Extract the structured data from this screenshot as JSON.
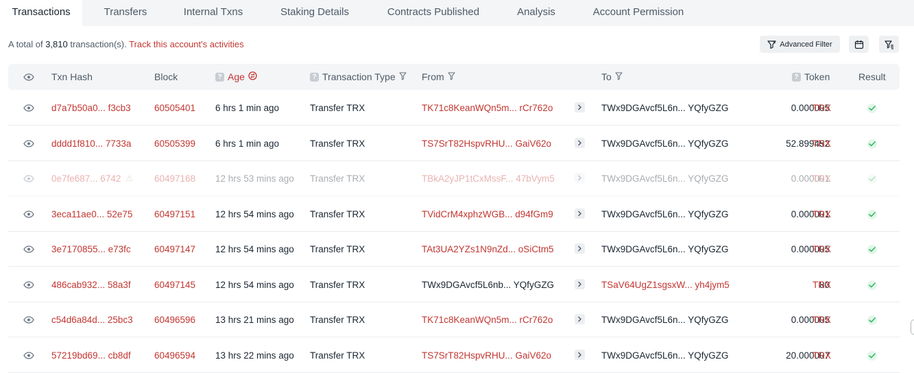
{
  "tabs": [
    {
      "label": "Transactions",
      "active": true
    },
    {
      "label": "Transfers"
    },
    {
      "label": "Internal Txns"
    },
    {
      "label": "Staking Details"
    },
    {
      "label": "Contracts Published"
    },
    {
      "label": "Analysis"
    },
    {
      "label": "Account Permission"
    }
  ],
  "summary": {
    "prefix": "A total of ",
    "count": "3,810",
    "suffix": " transaction(s).",
    "track_link": "Track this account's activities"
  },
  "toolbar": {
    "advanced_filter": "Advanced Filter",
    "calendar_icon": "calendar-icon",
    "filter_icon": "filter-list-icon"
  },
  "columns": {
    "txn_hash": "Txn Hash",
    "block": "Block",
    "age": "Age",
    "transaction_type": "Transaction Type",
    "from": "From",
    "to": "To",
    "token": "Token",
    "result": "Result"
  },
  "colors": {
    "accent_red": "#c23631",
    "success_green": "#2fb85d",
    "header_bg": "#f3f5f7"
  },
  "rows": [
    {
      "hash": "d7a7b50a0... f3cb3",
      "block": "60505401",
      "age": "6 hrs 1 min ago",
      "type": "Transfer TRX",
      "from": "TK71c8KeanWQn5m... rCr762o",
      "to": "TWx9DGAvcf5L6n... YQfyGZG",
      "amount": "0.000005",
      "token": "TRX"
    },
    {
      "hash": "dddd1f810... 7733a",
      "block": "60505399",
      "age": "6 hrs 1 min ago",
      "type": "Transfer TRX",
      "from": "TS7SrT82HspvRHU... GaiV62o",
      "to": "TWx9DGAvcf5L6n... YQfyGZG",
      "amount": "52.899452",
      "token": "TRX"
    },
    {
      "hash": "0e7fe687... 6742",
      "block": "60497168",
      "age": "12 hrs 53 mins ago",
      "type": "Transfer TRX",
      "from": "TBkA2yJP1tCxMssF... 47bVym5",
      "to": "TWx9DGAvcf5L6n... YQfyGZG",
      "amount": "0.000001",
      "token": "TRX",
      "faded": true
    },
    {
      "hash": "3eca11ae0... 52e75",
      "block": "60497151",
      "age": "12 hrs 54 mins ago",
      "type": "Transfer TRX",
      "from": "TVidCrM4xphzWGB... d94fGm9",
      "to": "TWx9DGAvcf5L6n... YQfyGZG",
      "amount": "0.000001",
      "token": "TRX"
    },
    {
      "hash": "3e7170855... e73fc",
      "block": "60497147",
      "age": "12 hrs 54 mins ago",
      "type": "Transfer TRX",
      "from": "TAt3UA2YZs1N9nZd... oSiCtm5",
      "to": "TWx9DGAvcf5L6n... YQfyGZG",
      "amount": "0.000005",
      "token": "TRX"
    },
    {
      "hash": "486cab932... 58a3f",
      "block": "60497145",
      "age": "12 hrs 54 mins ago",
      "type": "Transfer TRX",
      "from": "TWx9DGAvcf5L6nb... YQfyGZG",
      "to": "TSaV64UgZ1sgsxW... yh4jym5",
      "amount": "80",
      "token": "TRX",
      "outgoing": true
    },
    {
      "hash": "c54d6a84d... 25bc3",
      "block": "60496596",
      "age": "13 hrs 21 mins ago",
      "type": "Transfer TRX",
      "from": "TK71c8KeanWQn5m... rCr762o",
      "to": "TWx9DGAvcf5L6n... YQfyGZG",
      "amount": "0.000005",
      "token": "TRX"
    },
    {
      "hash": "57219bd69... cb8df",
      "block": "60496594",
      "age": "13 hrs 22 mins ago",
      "type": "Transfer TRX",
      "from": "TS7SrT82HspvRHU... GaiV62o",
      "to": "TWx9DGAvcf5L6n... YQfyGZG",
      "amount": "20.000007",
      "token": "TRX"
    }
  ]
}
